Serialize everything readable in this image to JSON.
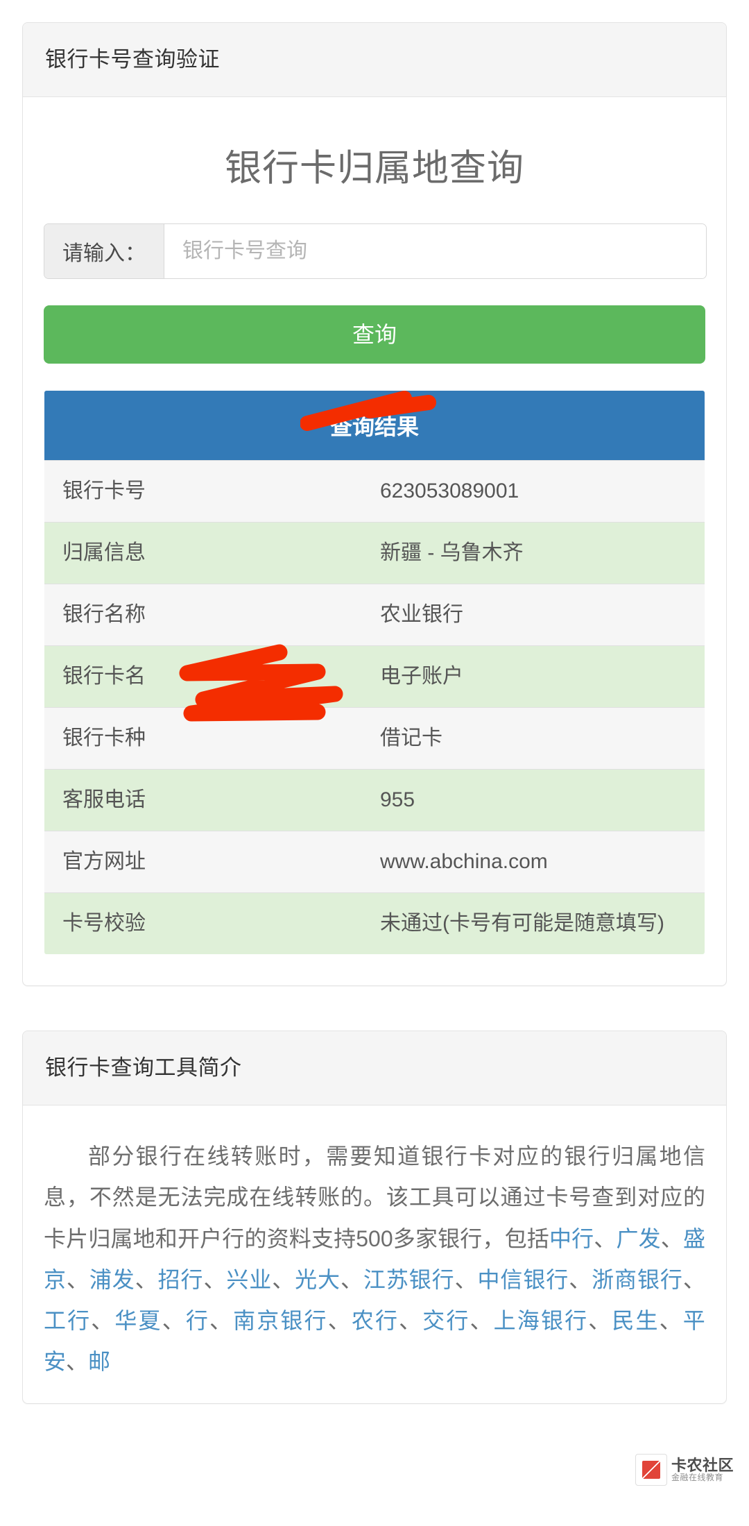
{
  "query_panel": {
    "heading": "银行卡号查询验证",
    "title": "银行卡归属地查询",
    "input": {
      "addon_label": "请输入：",
      "placeholder": "银行卡号查询",
      "value": ""
    },
    "submit_label": "查询",
    "result_header": "查询结果",
    "rows": [
      {
        "label": "银行卡号",
        "value": "623053089001",
        "redacted": true
      },
      {
        "label": "归属信息",
        "value": "新疆 - 乌鲁木齐",
        "redacted": false
      },
      {
        "label": "银行名称",
        "value": "农业银行",
        "redacted": false
      },
      {
        "label": "银行卡名",
        "value": "电子账户",
        "redacted": false
      },
      {
        "label": "银行卡种",
        "value": "借记卡",
        "redacted": false
      },
      {
        "label": "客服电话",
        "value": "955",
        "redacted": true
      },
      {
        "label": "官方网址",
        "value": "www.abchina.com",
        "redacted": true
      },
      {
        "label": "卡号校验",
        "value": "未通过(卡号有可能是随意填写)",
        "redacted": false
      }
    ]
  },
  "intro_panel": {
    "heading": "银行卡查询工具简介",
    "paragraph_part1": "部分银行在线转账时，需要知道银行卡对应的银行归属地信息，不然是无法完成在线转账的。该工具可以通过卡号查到对应的卡片归属地和开户行的资料支持500多家银行，包括",
    "bank_links": [
      "中行",
      "广发",
      "盛京",
      "浦发",
      "招行",
      "兴业",
      "光大",
      "江苏银行",
      "中信银行",
      "浙商银行",
      "工行",
      "华夏",
      "行",
      "南京银行",
      "农行",
      "交行",
      "上海银行",
      "民生",
      "平安",
      "邮"
    ],
    "separator": "、"
  },
  "watermark": {
    "title": "卡农社区",
    "subtitle": "金融在线教育"
  },
  "colors": {
    "green_button": "#5cb85c",
    "blue_header": "#337ab7",
    "row_green": "#dff0d8",
    "row_gray": "#f6f6f6",
    "link_blue": "#4a90c4",
    "scribble_red": "#f42d00"
  }
}
